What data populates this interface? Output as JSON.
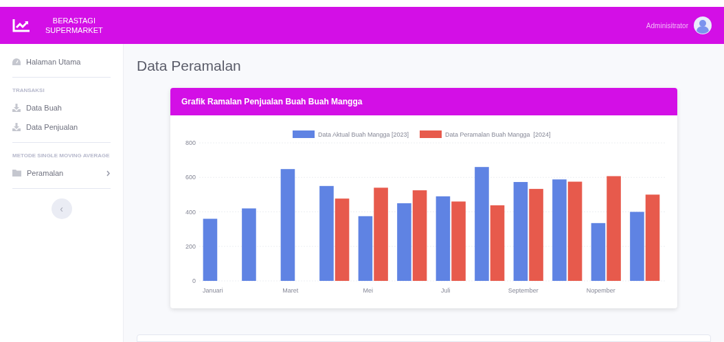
{
  "brand": {
    "line1": "BERASTAGI",
    "line2": "SUPERMARKET"
  },
  "user": {
    "name": "Adminisitrator"
  },
  "sidebar": {
    "items": [
      {
        "kind": "link",
        "label": "Halaman Utama",
        "selected": false
      },
      {
        "kind": "divider"
      },
      {
        "kind": "heading",
        "label": "TRANSAKSI"
      },
      {
        "kind": "link",
        "label": "Data Buah",
        "selected": false
      },
      {
        "kind": "link",
        "label": "Data Penjualan",
        "selected": false
      },
      {
        "kind": "divider"
      },
      {
        "kind": "heading",
        "label": "METODE SINGLE MOVING AVERAGE"
      },
      {
        "kind": "collapse",
        "label": "Peramalan",
        "selected": false,
        "expanded": false
      },
      {
        "kind": "divider"
      }
    ],
    "toggle": "‹"
  },
  "page": {
    "title": "Data Peramalan"
  },
  "card": {
    "title": "Grafik Ramalan Penjualan Buah Buah Mangga",
    "chart_data": {
      "type": "bar",
      "categories": [
        "Januari",
        null,
        "Maret",
        null,
        "Mei",
        null,
        "Juli",
        null,
        "September",
        null,
        "Nopember",
        null
      ],
      "ylim": [
        0,
        800
      ],
      "yticks": [
        0,
        200,
        400,
        600,
        800
      ],
      "stacked": false,
      "grid": true,
      "legend": "top",
      "series": [
        {
          "name": "Data Aktual Buah Mangga [2023]",
          "color": "#5f83e3",
          "values": [
            360,
            420,
            648,
            550,
            375,
            450,
            490,
            660,
            573,
            588,
            335,
            400
          ]
        },
        {
          "name": "Data Peramalan Buah Mangga  [2024]",
          "color": "#e75a4c",
          "values": [
            null,
            null,
            null,
            477,
            540,
            525,
            460,
            438,
            533,
            575,
            607,
            500
          ]
        }
      ]
    }
  }
}
